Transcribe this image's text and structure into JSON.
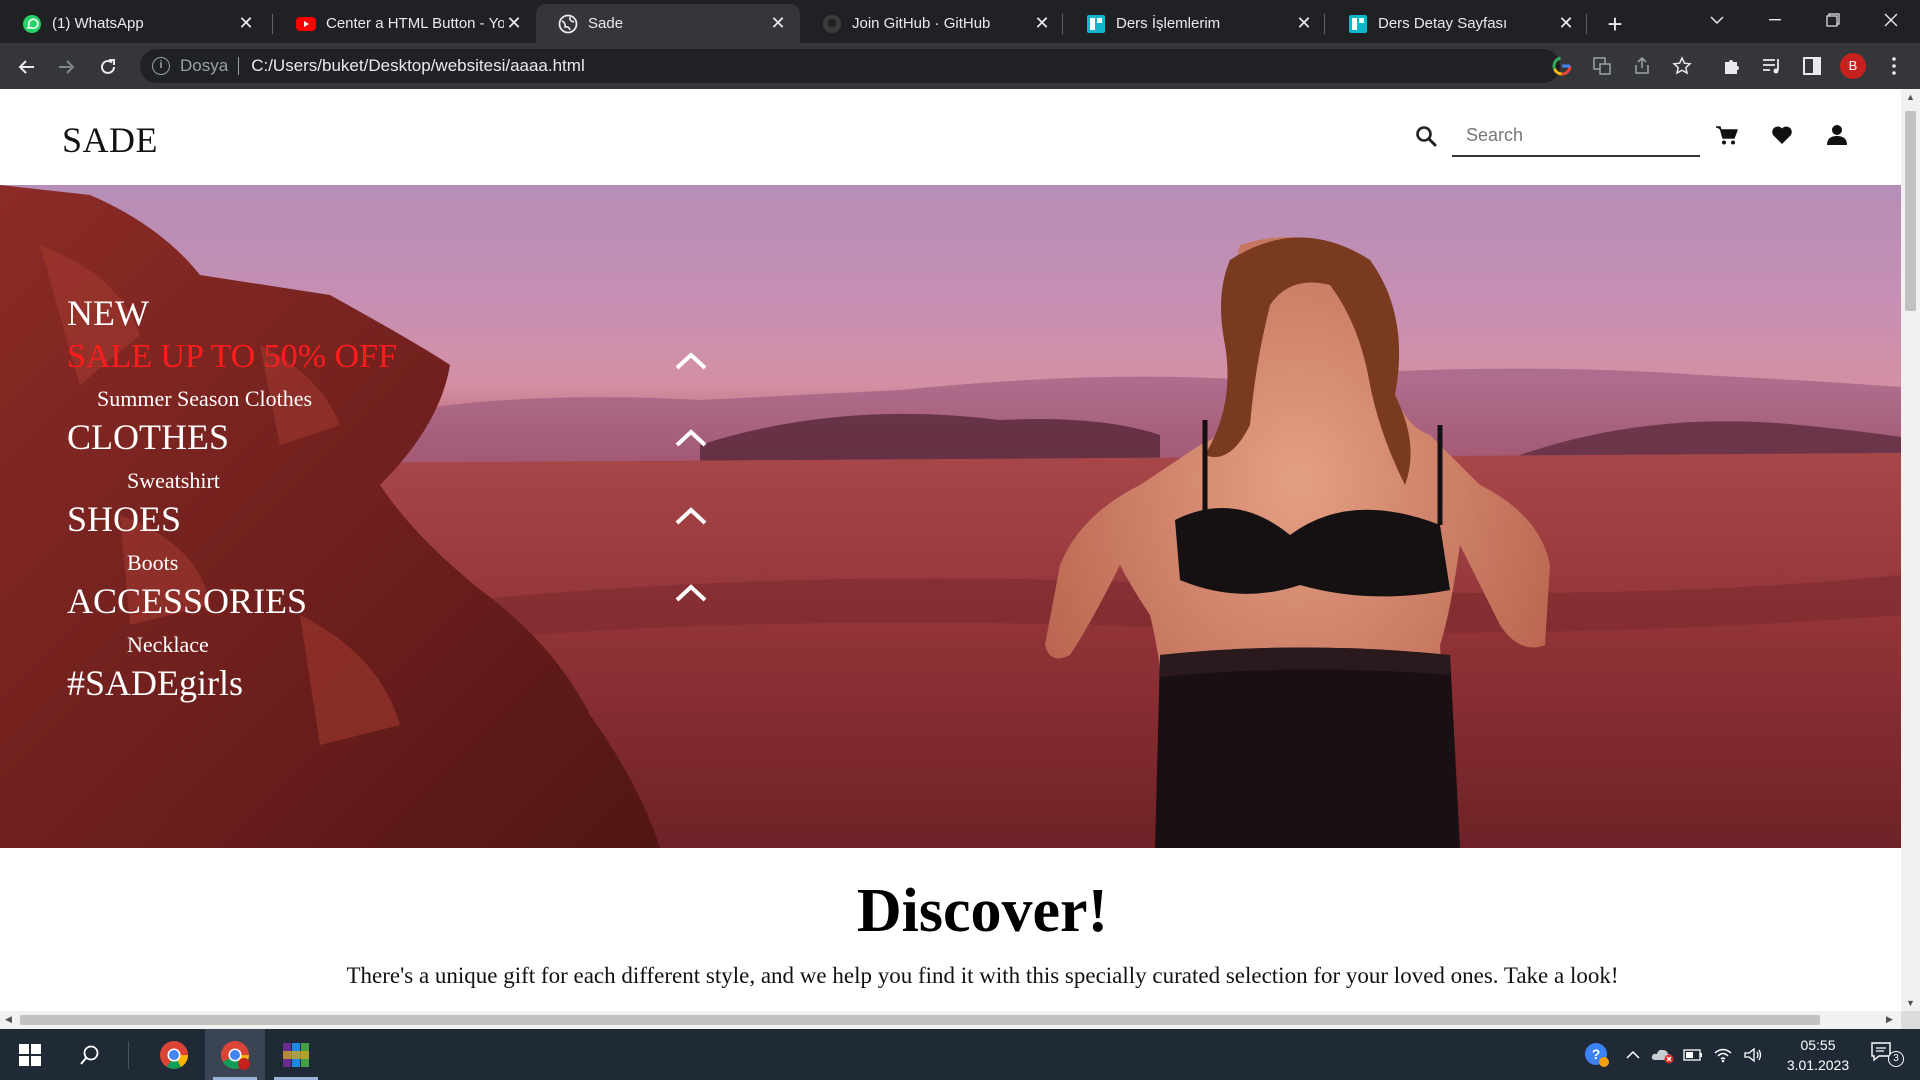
{
  "browser": {
    "tabs": [
      {
        "title": "(1) WhatsApp",
        "favicon": "whatsapp-icon",
        "color": "#25d366",
        "active": false
      },
      {
        "title": "Center a HTML Button - Yo",
        "favicon": "youtube-icon",
        "color": "#ff0000",
        "active": false
      },
      {
        "title": "Sade",
        "favicon": "globe-icon",
        "color": "#e8eaed",
        "active": true
      },
      {
        "title": "Join GitHub · GitHub",
        "favicon": "github-icon",
        "color": "#3c3c3c",
        "active": false
      },
      {
        "title": "Ders İşlemlerim",
        "favicon": "app-icon",
        "color": "#12b5cb",
        "active": false
      },
      {
        "title": "Ders Detay Sayfası",
        "favicon": "app-icon",
        "color": "#12b5cb",
        "active": false
      }
    ],
    "omnibox": {
      "scheme_label": "Dosya",
      "url": "C:/Users/buket/Desktop/websitesi/aaaa.html"
    },
    "profile_initial": "B"
  },
  "site": {
    "logo": "SADE",
    "search_placeholder": "Search",
    "menu": {
      "new": "NEW",
      "sale": "SALE UP TO 50% OFF",
      "sale_color": "#ff1c1c",
      "summer": "Summer Season Clothes",
      "clothes": "CLOTHES",
      "sweatshirt": "Sweatshirt",
      "shoes": "SHOES",
      "boots": "Boots",
      "accessories": "ACCESSORIES",
      "necklace": "Necklace",
      "hashtag": "#SADEgirls"
    },
    "discover": {
      "title": "Discover!",
      "text": "There's a unique gift for each different style, and we help you find it with this specially curated selection for your loved ones. Take a look!"
    }
  },
  "taskbar": {
    "time": "05:55",
    "date": "3.01.2023",
    "notification_count": "3"
  }
}
